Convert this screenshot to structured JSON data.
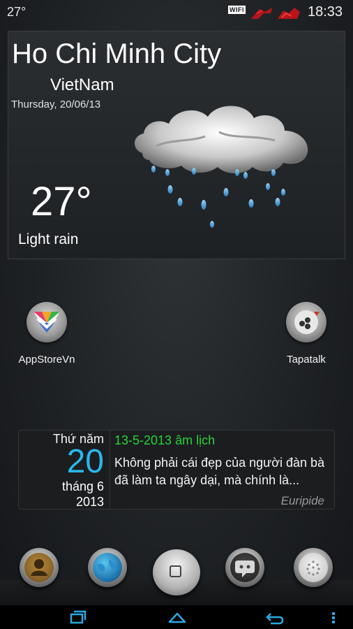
{
  "status_bar": {
    "temperature": "27°",
    "wifi_label": "WIFI",
    "time": "18:33"
  },
  "weather": {
    "city": "Ho Chi Minh City",
    "country": "VietNam",
    "date": "Thursday, 20/06/13",
    "temperature": "27°",
    "condition": "Light rain",
    "icon": "cloud-rain-icon"
  },
  "apps": [
    {
      "label": "AppStoreVn",
      "icon": "appstorevn-icon"
    },
    {
      "label": "Tapatalk",
      "icon": "tapatalk-icon"
    }
  ],
  "calendar": {
    "day_of_week": "Thứ năm",
    "day": "20",
    "month": "tháng 6",
    "year": "2013",
    "lunar_date": "13-5-2013 âm lịch",
    "quote": "Không phải cái đẹp của người đàn bà đã làm ta ngây dại, mà chính là...",
    "author": "Euripide"
  },
  "dock": [
    {
      "icon": "contacts-icon"
    },
    {
      "icon": "browser-icon"
    },
    {
      "icon": "home-icon"
    },
    {
      "icon": "messaging-icon"
    },
    {
      "icon": "app-drawer-icon"
    }
  ],
  "nav": {
    "recent_icon": "recent-apps-icon",
    "home_icon": "home-nav-icon",
    "back_icon": "back-icon",
    "menu_icon": "menu-icon"
  },
  "colors": {
    "accent_blue": "#2bb6ea",
    "lunar_green": "#27d43a",
    "nav_blue": "#2aa8e0"
  }
}
